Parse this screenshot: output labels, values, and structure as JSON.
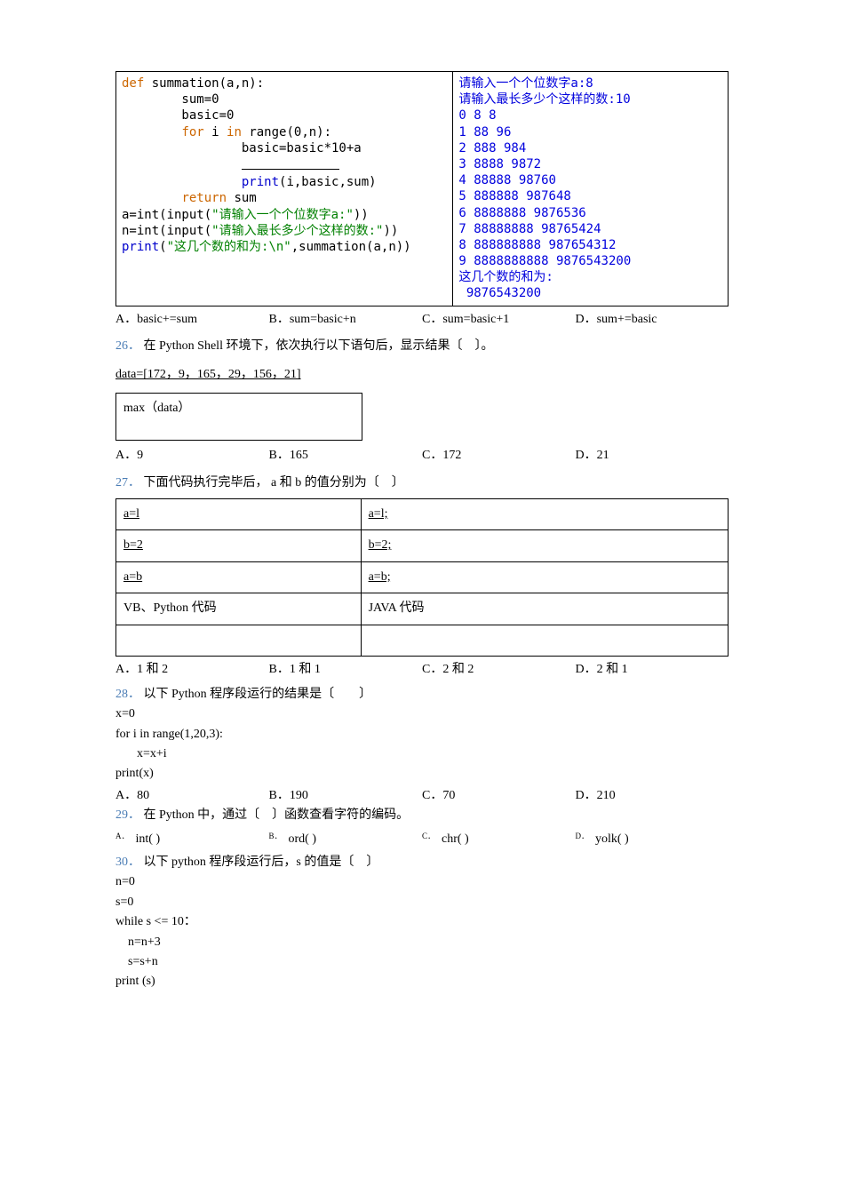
{
  "q25": {
    "code_left_raw": "def summation(a,n):\n        sum=0\n        basic=0\n        for i in range(0,n):\n                basic=basic*10+a\n                ____________\n                print(i,basic,sum)\n        return sum\na=int(input(\"请输入一个个位数字a:\"))\nn=int(input(\"请输入最长多少个这样的数:\"))\nprint(\"这几个数的和为:\\n\",summation(a,n))",
    "code_right": "请输入一个个位数字a:8\n请输入最长多少个这样的数:10\n0 8 8\n1 88 96\n2 888 984\n3 8888 9872\n4 88888 98760\n5 888888 987648\n6 8888888 9876536\n7 88888888 98765424\n8 888888888 987654312\n9 8888888888 9876543200\n这几个数的和为:\n 9876543200",
    "optA": "A．basic+=sum",
    "optB": "B．sum=basic+n",
    "optC": "C．sum=basic+1",
    "optD": "D．sum+=basic"
  },
  "q26": {
    "num": "26．",
    "text": "在 Python Shell 环境下，依次执行以下语句后，显示结果〔　〕。",
    "data_line": "data=[172，9，165，29，156，21]",
    "max_line": "max（data）",
    "optA": "A．9",
    "optB": "B．165",
    "optC": "C．172",
    "optD": "D．21"
  },
  "q27": {
    "num": "27．",
    "text": "下面代码执行完毕后， a 和 b 的值分别为〔　〕",
    "cells": {
      "l1": "a=l",
      "r1": "a=l;",
      "l2": "b=2",
      "r2": "b=2;",
      "l3": "a=b",
      "r3": "a=b;",
      "l4": "VB、Python 代码",
      "r4": "JAVA 代码"
    },
    "optA": "A．1 和 2",
    "optB": "B．1 和 1",
    "optC": "C．2 和 2",
    "optD": "D．2 和 1"
  },
  "q28": {
    "num": "28．",
    "text": "以下 Python 程序段运行的结果是〔　　〕",
    "c1": "x=0",
    "c2": "for i in range(1,20,3):",
    "c3": "x=x+i",
    "c4": "print(x)",
    "optA": "A．80",
    "optB": "B．190",
    "optC": "C．70",
    "optD": "D．210"
  },
  "q29": {
    "num": "29．",
    "text": "在 Python 中，通过〔　〕函数查看字符的编码。",
    "optA": "int( )",
    "optB": "ord( )",
    "optC": "chr( )",
    "optD": "yolk( )"
  },
  "q30": {
    "num": "30．",
    "text": "以下 python 程序段运行后，s 的值是〔　〕",
    "c1": "n=0",
    "c2": "s=0",
    "c3": "while  s <= 10：",
    "c4": "n=n+3",
    "c5": "s=s+n",
    "c6": "print (s)"
  }
}
